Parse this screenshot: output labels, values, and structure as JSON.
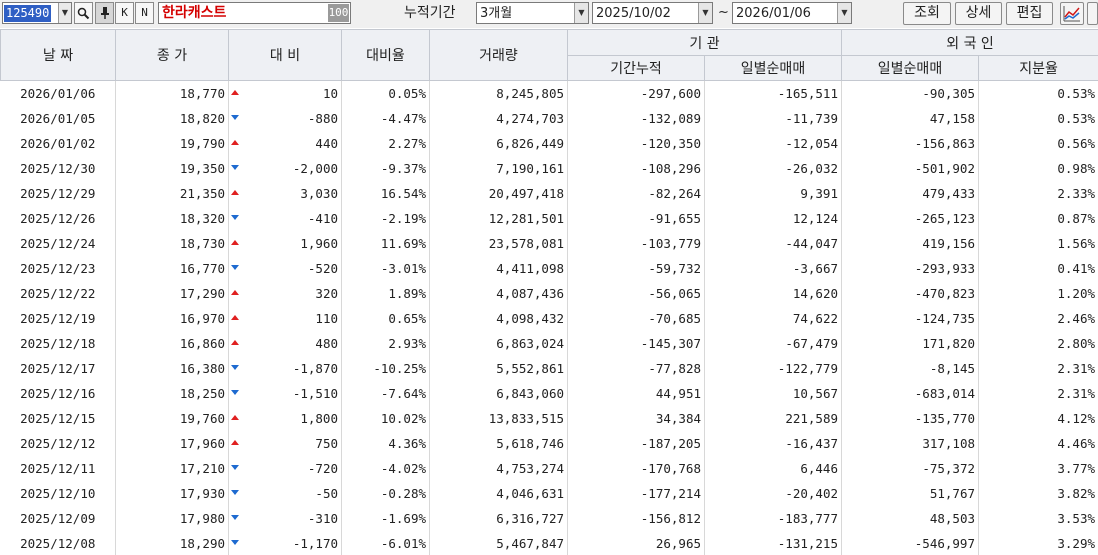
{
  "toolbar": {
    "code": "125490",
    "btn_k": "K",
    "btn_n": "N",
    "stock_name": "한라캐스트",
    "name_btn": "100",
    "period_label": "누적기간",
    "period_value": "3개월",
    "start_date": "2025/10/02",
    "tilde": "~",
    "end_date": "2026/01/06",
    "btn_query": "조회",
    "btn_detail": "상세",
    "btn_edit": "편집"
  },
  "colors": {
    "up": "#d01818",
    "down": "#1e6ad0",
    "selected": "#2f5fc4"
  },
  "headers": {
    "date": "날 짜",
    "close": "종 가",
    "change": "대 비",
    "change_rate": "대비율",
    "volume": "거래량",
    "institution": "기  관",
    "inst_cumulative": "기간누적",
    "inst_daily_net": "일별순매매",
    "foreign": "외 국 인",
    "foreign_daily_net": "일별순매매",
    "foreign_ratio": "지분율"
  },
  "rows": [
    {
      "date": "2026/01/06",
      "close": "18,770",
      "dir": "up",
      "change": "10",
      "rate": "0.05%",
      "volume": "8,245,805",
      "inst_cum": "-297,600",
      "inst_daily": "-165,511",
      "for_daily": "-90,305",
      "ratio": "0.53%"
    },
    {
      "date": "2026/01/05",
      "close": "18,820",
      "dir": "down",
      "change": "-880",
      "rate": "-4.47%",
      "volume": "4,274,703",
      "inst_cum": "-132,089",
      "inst_daily": "-11,739",
      "for_daily": "47,158",
      "ratio": "0.53%"
    },
    {
      "date": "2026/01/02",
      "close": "19,790",
      "dir": "up",
      "change": "440",
      "rate": "2.27%",
      "volume": "6,826,449",
      "inst_cum": "-120,350",
      "inst_daily": "-12,054",
      "for_daily": "-156,863",
      "ratio": "0.56%"
    },
    {
      "date": "2025/12/30",
      "close": "19,350",
      "dir": "down",
      "change": "-2,000",
      "rate": "-9.37%",
      "volume": "7,190,161",
      "inst_cum": "-108,296",
      "inst_daily": "-26,032",
      "for_daily": "-501,902",
      "ratio": "0.98%"
    },
    {
      "date": "2025/12/29",
      "close": "21,350",
      "dir": "up",
      "change": "3,030",
      "rate": "16.54%",
      "volume": "20,497,418",
      "inst_cum": "-82,264",
      "inst_daily": "9,391",
      "for_daily": "479,433",
      "ratio": "2.33%"
    },
    {
      "date": "2025/12/26",
      "close": "18,320",
      "dir": "down",
      "change": "-410",
      "rate": "-2.19%",
      "volume": "12,281,501",
      "inst_cum": "-91,655",
      "inst_daily": "12,124",
      "for_daily": "-265,123",
      "ratio": "0.87%"
    },
    {
      "date": "2025/12/24",
      "close": "18,730",
      "dir": "up",
      "change": "1,960",
      "rate": "11.69%",
      "volume": "23,578,081",
      "inst_cum": "-103,779",
      "inst_daily": "-44,047",
      "for_daily": "419,156",
      "ratio": "1.56%"
    },
    {
      "date": "2025/12/23",
      "close": "16,770",
      "dir": "down",
      "change": "-520",
      "rate": "-3.01%",
      "volume": "4,411,098",
      "inst_cum": "-59,732",
      "inst_daily": "-3,667",
      "for_daily": "-293,933",
      "ratio": "0.41%"
    },
    {
      "date": "2025/12/22",
      "close": "17,290",
      "dir": "up",
      "change": "320",
      "rate": "1.89%",
      "volume": "4,087,436",
      "inst_cum": "-56,065",
      "inst_daily": "14,620",
      "for_daily": "-470,823",
      "ratio": "1.20%"
    },
    {
      "date": "2025/12/19",
      "close": "16,970",
      "dir": "up",
      "change": "110",
      "rate": "0.65%",
      "volume": "4,098,432",
      "inst_cum": "-70,685",
      "inst_daily": "74,622",
      "for_daily": "-124,735",
      "ratio": "2.46%"
    },
    {
      "date": "2025/12/18",
      "close": "16,860",
      "dir": "up",
      "change": "480",
      "rate": "2.93%",
      "volume": "6,863,024",
      "inst_cum": "-145,307",
      "inst_daily": "-67,479",
      "for_daily": "171,820",
      "ratio": "2.80%"
    },
    {
      "date": "2025/12/17",
      "close": "16,380",
      "dir": "down",
      "change": "-1,870",
      "rate": "-10.25%",
      "volume": "5,552,861",
      "inst_cum": "-77,828",
      "inst_daily": "-122,779",
      "for_daily": "-8,145",
      "ratio": "2.31%"
    },
    {
      "date": "2025/12/16",
      "close": "18,250",
      "dir": "down",
      "change": "-1,510",
      "rate": "-7.64%",
      "volume": "6,843,060",
      "inst_cum": "44,951",
      "inst_daily": "10,567",
      "for_daily": "-683,014",
      "ratio": "2.31%"
    },
    {
      "date": "2025/12/15",
      "close": "19,760",
      "dir": "up",
      "change": "1,800",
      "rate": "10.02%",
      "volume": "13,833,515",
      "inst_cum": "34,384",
      "inst_daily": "221,589",
      "for_daily": "-135,770",
      "ratio": "4.12%"
    },
    {
      "date": "2025/12/12",
      "close": "17,960",
      "dir": "up",
      "change": "750",
      "rate": "4.36%",
      "volume": "5,618,746",
      "inst_cum": "-187,205",
      "inst_daily": "-16,437",
      "for_daily": "317,108",
      "ratio": "4.46%"
    },
    {
      "date": "2025/12/11",
      "close": "17,210",
      "dir": "down",
      "change": "-720",
      "rate": "-4.02%",
      "volume": "4,753,274",
      "inst_cum": "-170,768",
      "inst_daily": "6,446",
      "for_daily": "-75,372",
      "ratio": "3.77%"
    },
    {
      "date": "2025/12/10",
      "close": "17,930",
      "dir": "down",
      "change": "-50",
      "rate": "-0.28%",
      "volume": "4,046,631",
      "inst_cum": "-177,214",
      "inst_daily": "-20,402",
      "for_daily": "51,767",
      "ratio": "3.82%"
    },
    {
      "date": "2025/12/09",
      "close": "17,980",
      "dir": "down",
      "change": "-310",
      "rate": "-1.69%",
      "volume": "6,316,727",
      "inst_cum": "-156,812",
      "inst_daily": "-183,777",
      "for_daily": "48,503",
      "ratio": "3.53%"
    },
    {
      "date": "2025/12/08",
      "close": "18,290",
      "dir": "down",
      "change": "-1,170",
      "rate": "-6.01%",
      "volume": "5,467,847",
      "inst_cum": "26,965",
      "inst_daily": "-131,215",
      "for_daily": "-546,997",
      "ratio": "3.29%"
    }
  ]
}
